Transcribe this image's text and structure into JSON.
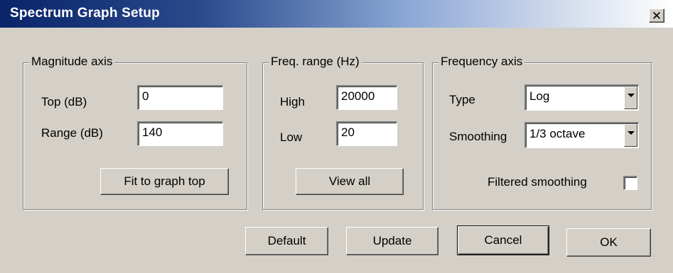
{
  "window": {
    "title": "Spectrum Graph Setup",
    "close_glyph": "✕"
  },
  "magnitude_axis": {
    "legend": "Magnitude axis",
    "top_label": "Top (dB)",
    "top_value": "0",
    "range_label": "Range (dB)",
    "range_value": "140",
    "fit_button": "Fit to graph top"
  },
  "freq_range": {
    "legend": "Freq. range (Hz)",
    "high_label": "High",
    "high_value": "20000",
    "low_label": "Low",
    "low_value": "20",
    "view_all_button": "View all"
  },
  "frequency_axis": {
    "legend": "Frequency axis",
    "type_label": "Type",
    "type_value": "Log",
    "smoothing_label": "Smoothing",
    "smoothing_value": "1/3 octave",
    "filtered_label": "Filtered smoothing",
    "filtered_checked": false
  },
  "buttons": {
    "default": "Default",
    "update": "Update",
    "cancel": "Cancel",
    "ok": "OK"
  },
  "icons": {
    "close": "close-icon",
    "dropdown": "chevron-down-icon"
  },
  "colors": {
    "title_bar_start": "#0a246a",
    "title_bar_end": "#ffffff",
    "dialog_background": "#d4d0c8"
  }
}
